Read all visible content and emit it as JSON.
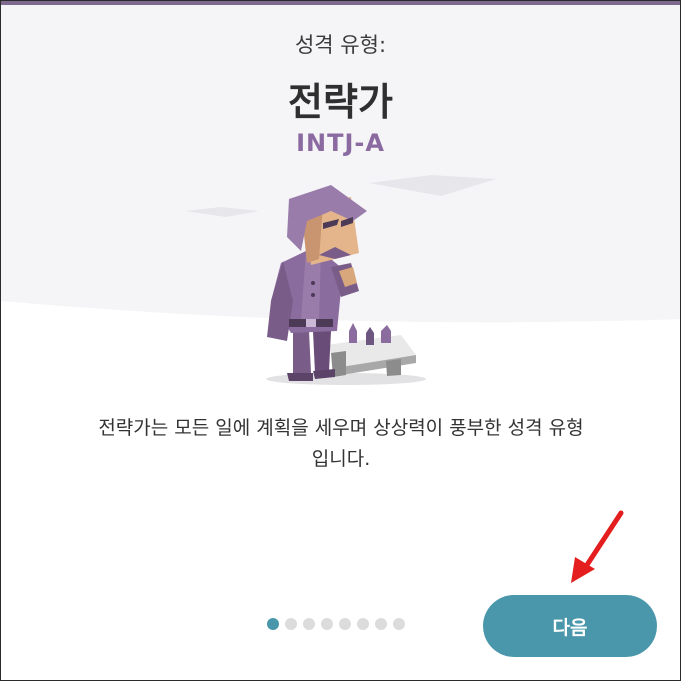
{
  "header": {
    "subtitle": "성격 유형:",
    "title": "전략가",
    "code": "INTJ-A"
  },
  "description": "전략가는 모든 일에 계획을 세우며 상상력이 풍부한 성격 유형입니다.",
  "pagination": {
    "total": 8,
    "current": 1
  },
  "next_button": {
    "label": "다음"
  },
  "annotation": {
    "arrow_color": "#e41e1e",
    "target": "next-button"
  },
  "colors": {
    "accent": "#4a97ab",
    "type_code": "#8a6aa0",
    "top_bar": "#7d6a8e"
  }
}
